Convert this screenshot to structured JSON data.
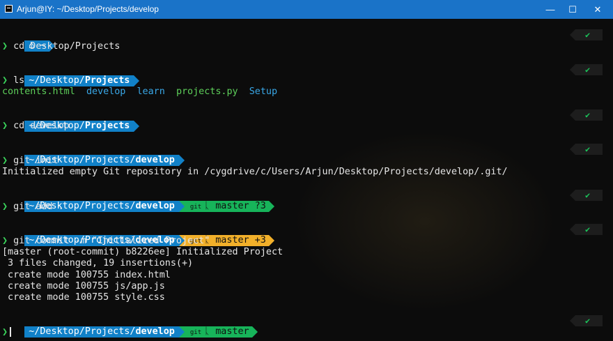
{
  "window": {
    "title": "Arjun@IY: ~/Desktop/Projects/develop",
    "icon": "terminal-icon",
    "controls": {
      "minimize": "—",
      "maximize": "☐",
      "close": "✕"
    }
  },
  "colors": {
    "dir_segment": "#1181c8",
    "git_clean": "#17b45a",
    "git_dirty": "#f2b02a",
    "ok_mark": "#1bc45a"
  },
  "prompts": [
    {
      "path_prefix": "~",
      "home": true,
      "bold": "",
      "git": null,
      "status": "✔"
    },
    {
      "path_prefix": "~/Desktop/",
      "bold": "Projects",
      "git": null,
      "status": "✔"
    },
    {
      "path_prefix": "~/Desktop/",
      "bold": "Projects",
      "git": null,
      "status": "✔"
    },
    {
      "path_prefix": "~/Desktop/Projects/",
      "bold": "develop",
      "git": null,
      "status": "✔"
    },
    {
      "path_prefix": "~/Desktop/Projects/",
      "bold": "develop",
      "git": {
        "tag": "git",
        "branch": "ᚳ master ?3"
      },
      "status": "✔"
    },
    {
      "path_prefix": "~/Desktop/Projects/",
      "bold": "develop",
      "git": {
        "tag": "git",
        "branch": "ᚳ master +3"
      },
      "status": "✔"
    },
    {
      "path_prefix": "~/Desktop/Projects/",
      "bold": "develop",
      "git": {
        "tag": "git",
        "branch": "ᚳ master"
      },
      "status": "✔"
    }
  ],
  "prompt_symbol": "❯",
  "commands": [
    "cd Desktop/Projects",
    "ls",
    "cd develop",
    "git init",
    "git add .",
    "git commit -m \"Initialized Project\""
  ],
  "ls_output": [
    {
      "name": "contents.html",
      "kind": "file"
    },
    {
      "name": "develop",
      "kind": "dir"
    },
    {
      "name": "learn",
      "kind": "dir"
    },
    {
      "name": "projects.py",
      "kind": "file"
    },
    {
      "name": "Setup",
      "kind": "dir"
    }
  ],
  "git_init_output": "Initialized empty Git repository in /cygdrive/c/Users/Arjun/Desktop/Projects/develop/.git/",
  "commit_output": [
    "[master (root-commit) b8226ee] Initialized Project",
    " 3 files changed, 19 insertions(+)",
    " create mode 100755 index.html",
    " create mode 100755 js/app.js",
    " create mode 100755 style.css"
  ],
  "home_glyph": "⌂"
}
